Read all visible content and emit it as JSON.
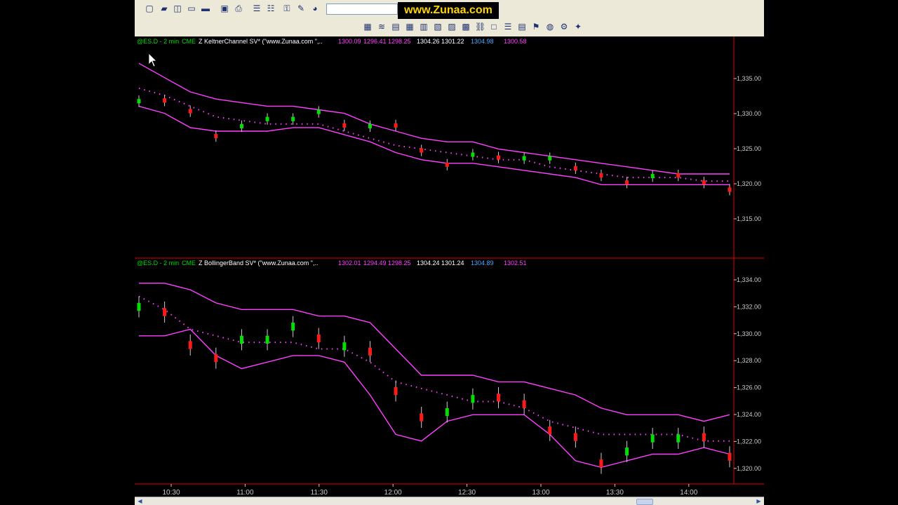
{
  "toolbar": {
    "brand": "www.Zunaa.com",
    "icons": [
      "new-icon",
      "open-icon",
      "layouts-icon",
      "save-icon",
      "folder-icon",
      "window-icon",
      "print-icon",
      "copy-chart-icon",
      "paste-chart-icon",
      "lock-icon",
      "drawing-tool-icon",
      "color-palette-icon"
    ],
    "row2_icons": [
      "bar-chart-icon",
      "indicator-icon",
      "data-window-icon",
      "grid-icon",
      "table-icon",
      "calendar-icon",
      "scanner-icon",
      "matrix-icon",
      "link-icon",
      "box-icon",
      "list-icon",
      "news-icon",
      "alerts-icon",
      "globe-icon",
      "strategy-icon",
      "optimize-icon"
    ]
  },
  "colors": {
    "up": "#00e000",
    "down": "#ff1a1a",
    "band": "#ff40ff",
    "dots": "#ff40ff",
    "redline": "#e00000",
    "axis_text": "#c8c8c8"
  },
  "panel1": {
    "symbol": "@ES.D - 2 min",
    "exchange": "CME",
    "study": "Z KeltnerChannel SV* (\"www.Zunaa.com \",..",
    "values": [
      {
        "text": "1300.09",
        "color": "#ff40ff"
      },
      {
        "text": "1296.41",
        "color": "#ff40ff"
      },
      {
        "text": "1298.25",
        "color": "#ff40ff"
      },
      {
        "text": "1304.26",
        "color": "#ffffff"
      },
      {
        "text": "1301.22",
        "color": "#ffffff"
      },
      {
        "text": "1304.98",
        "color": "#4aa8ff"
      },
      {
        "text": "1300.58",
        "color": "#ff40ff"
      }
    ],
    "price_labels": [
      "1,335.00",
      "1,330.00",
      "1,325.00",
      "1,320.00",
      "1,315.00"
    ]
  },
  "panel2": {
    "symbol": "@ES.D - 2 min",
    "exchange": "CME",
    "study": "Z BollingerBand SV* (\"www.Zunaa.com \",..",
    "values": [
      {
        "text": "1302.01",
        "color": "#ff40ff"
      },
      {
        "text": "1294.49",
        "color": "#ff40ff"
      },
      {
        "text": "1298.25",
        "color": "#ff40ff"
      },
      {
        "text": "1304.24",
        "color": "#ffffff"
      },
      {
        "text": "1301.24",
        "color": "#ffffff"
      },
      {
        "text": "1304.89",
        "color": "#4aa8ff"
      },
      {
        "text": "1302.51",
        "color": "#ff40ff"
      }
    ],
    "price_labels": [
      "1,334.00",
      "1,332.00",
      "1,330.00",
      "1,328.00",
      "1,326.00",
      "1,324.00",
      "1,322.00",
      "1,320.00"
    ]
  },
  "time_labels": [
    "10:30",
    "11:00",
    "11:30",
    "12:00",
    "12:30",
    "13:00",
    "13:30",
    "14:00"
  ],
  "chart_data": [
    {
      "type": "candlestick",
      "title": "@ES.D - 2 min  CME  Z KeltnerChannel SV*",
      "x": [
        "10:30",
        "11:00",
        "11:30",
        "12:00",
        "12:30",
        "13:00",
        "13:30",
        "14:00"
      ],
      "ylim": [
        1311,
        1340
      ],
      "candle_close": [
        1333.0,
        1332.5,
        1331.0,
        1327.5,
        1329.5,
        1330.5,
        1330.5,
        1331.5,
        1329.0,
        1329.5,
        1329.0,
        1325.5,
        1323.5,
        1325.5,
        1324.5,
        1325.0,
        1325.0,
        1323.0,
        1322.0,
        1321.0,
        1322.5,
        1322.0,
        1321.0,
        1320.0
      ],
      "series": [
        {
          "name": "upper",
          "values": [
            1338.0,
            1336.0,
            1334.0,
            1333.0,
            1332.5,
            1332.0,
            1332.0,
            1331.5,
            1331.0,
            1329.5,
            1328.5,
            1327.5,
            1327.0,
            1327.0,
            1326.0,
            1325.5,
            1325.0,
            1324.5,
            1324.0,
            1323.5,
            1323.0,
            1322.5,
            1322.5,
            1322.5
          ]
        },
        {
          "name": "middle",
          "values": [
            1334.5,
            1333.5,
            1332.0,
            1330.5,
            1330.0,
            1329.5,
            1329.5,
            1329.5,
            1328.5,
            1327.5,
            1326.5,
            1326.0,
            1325.5,
            1325.0,
            1324.5,
            1324.5,
            1323.5,
            1323.0,
            1322.5,
            1322.0,
            1322.0,
            1322.0,
            1321.5,
            1321.5
          ]
        },
        {
          "name": "lower",
          "values": [
            1332.0,
            1331.0,
            1329.0,
            1328.5,
            1328.5,
            1328.5,
            1329.0,
            1329.0,
            1328.0,
            1327.0,
            1325.5,
            1324.5,
            1324.0,
            1324.0,
            1323.5,
            1323.0,
            1322.5,
            1322.0,
            1321.0,
            1321.0,
            1321.0,
            1321.0,
            1321.0,
            1321.0
          ]
        }
      ]
    },
    {
      "type": "candlestick",
      "title": "@ES.D - 2 min  CME  Z BollingerBand SV*",
      "x": [
        "10:30",
        "11:00",
        "11:30",
        "12:00",
        "12:30",
        "13:00",
        "13:30",
        "14:00"
      ],
      "ylim": [
        1319,
        1335
      ],
      "candle_close": [
        1332.5,
        1331.5,
        1329.0,
        1328.0,
        1330.0,
        1330.0,
        1331.0,
        1329.5,
        1329.5,
        1328.5,
        1325.5,
        1323.5,
        1324.5,
        1325.5,
        1325.0,
        1324.5,
        1322.5,
        1322.0,
        1320.0,
        1321.5,
        1322.5,
        1322.5,
        1322.0,
        1320.5
      ],
      "series": [
        {
          "name": "upper",
          "values": [
            1334.0,
            1334.0,
            1333.5,
            1332.5,
            1332.0,
            1332.0,
            1332.0,
            1331.5,
            1331.5,
            1331.0,
            1329.0,
            1327.0,
            1327.0,
            1327.0,
            1326.5,
            1326.5,
            1326.0,
            1325.5,
            1324.5,
            1324.0,
            1324.0,
            1324.0,
            1323.5,
            1324.0
          ]
        },
        {
          "name": "middle",
          "values": [
            1333.0,
            1332.0,
            1330.5,
            1330.0,
            1329.5,
            1329.5,
            1329.5,
            1329.0,
            1329.0,
            1328.0,
            1326.5,
            1326.0,
            1325.5,
            1325.0,
            1325.0,
            1324.5,
            1323.5,
            1323.0,
            1322.5,
            1322.5,
            1322.5,
            1322.5,
            1322.0,
            1322.0
          ]
        },
        {
          "name": "lower",
          "values": [
            1330.0,
            1330.0,
            1330.5,
            1328.5,
            1327.5,
            1328.0,
            1328.5,
            1328.5,
            1328.0,
            1325.5,
            1322.5,
            1322.0,
            1323.5,
            1324.0,
            1324.0,
            1324.0,
            1322.5,
            1320.5,
            1320.0,
            1320.5,
            1321.0,
            1321.0,
            1321.5,
            1321.0
          ]
        }
      ]
    }
  ]
}
